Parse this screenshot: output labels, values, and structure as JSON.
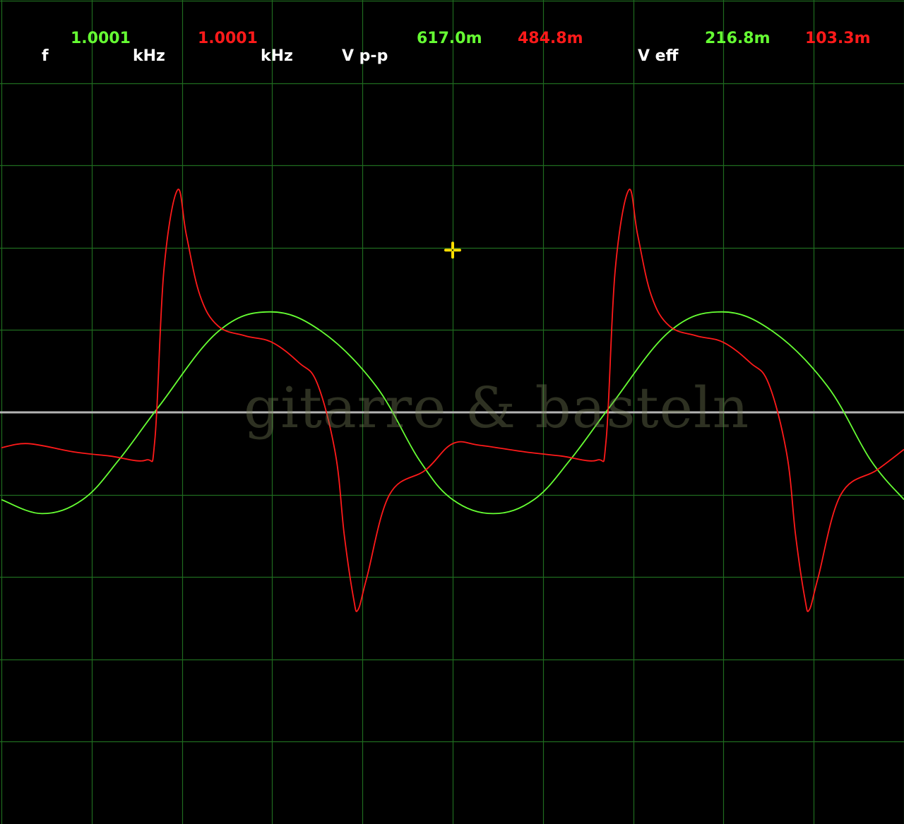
{
  "readouts": {
    "freq_label": "f",
    "freq_ch1": "1.0001",
    "freq_unit_ch1": "kHz",
    "freq_ch2": "1.0001",
    "freq_unit_ch2": "kHz",
    "vpp_label": "V p-p",
    "vpp_ch1": "617.0m",
    "vpp_ch2": "484.8m",
    "veff_label": "V eff",
    "veff_ch1": "216.8m",
    "veff_ch2": "103.3m"
  },
  "watermark": "gitarre & basteln",
  "colors": {
    "background": "#000000",
    "grid": "#1f6b1f",
    "ch1": "#66ff33",
    "ch2": "#ff1a1a",
    "zero_line": "#b4b4b4",
    "cursor": "#ffdd00"
  },
  "chart_data": {
    "type": "line",
    "title": "",
    "xlabel": "",
    "ylabel": "",
    "grid": true,
    "grid_divisions": {
      "x": 10,
      "y": 10
    },
    "xlim": [
      0,
      10
    ],
    "ylim": [
      -5,
      5
    ],
    "zero_line": 0,
    "cursor": {
      "x": 5.0,
      "y": 1.97
    },
    "series": [
      {
        "channel": "ch1",
        "color": "#66ff33",
        "points": [
          [
            0.0,
            -1.06
          ],
          [
            0.45,
            -1.23
          ],
          [
            0.9,
            -1.06
          ],
          [
            1.3,
            -0.58
          ],
          [
            1.75,
            0.08
          ],
          [
            2.4,
            0.98
          ],
          [
            2.98,
            1.22
          ],
          [
            3.55,
            0.98
          ],
          [
            4.15,
            0.32
          ],
          [
            4.63,
            -0.58
          ],
          [
            5.0,
            -1.06
          ],
          [
            5.45,
            -1.23
          ],
          [
            5.9,
            -1.06
          ],
          [
            6.3,
            -0.58
          ],
          [
            6.75,
            0.08
          ],
          [
            7.4,
            0.98
          ],
          [
            7.98,
            1.22
          ],
          [
            8.55,
            0.98
          ],
          [
            9.15,
            0.32
          ],
          [
            9.63,
            -0.58
          ],
          [
            10.0,
            -1.06
          ]
        ]
      },
      {
        "channel": "ch2",
        "color": "#ff1a1a",
        "points": [
          [
            0.0,
            -0.43
          ],
          [
            0.3,
            -0.38
          ],
          [
            0.8,
            -0.48
          ],
          [
            1.2,
            -0.53
          ],
          [
            1.6,
            -0.58
          ],
          [
            1.7,
            -0.33
          ],
          [
            1.8,
            1.72
          ],
          [
            1.95,
            2.7
          ],
          [
            2.05,
            2.15
          ],
          [
            2.2,
            1.42
          ],
          [
            2.4,
            1.05
          ],
          [
            2.7,
            0.93
          ],
          [
            3.0,
            0.85
          ],
          [
            3.3,
            0.6
          ],
          [
            3.5,
            0.35
          ],
          [
            3.7,
            -0.5
          ],
          [
            3.8,
            -1.5
          ],
          [
            3.9,
            -2.25
          ],
          [
            3.95,
            -2.4
          ],
          [
            4.05,
            -2.0
          ],
          [
            4.3,
            -1.0
          ],
          [
            4.7,
            -0.7
          ],
          [
            5.0,
            -0.38
          ],
          [
            5.3,
            -0.4
          ],
          [
            5.8,
            -0.48
          ],
          [
            6.2,
            -0.53
          ],
          [
            6.6,
            -0.58
          ],
          [
            6.7,
            -0.33
          ],
          [
            6.8,
            1.72
          ],
          [
            6.95,
            2.7
          ],
          [
            7.05,
            2.15
          ],
          [
            7.2,
            1.42
          ],
          [
            7.4,
            1.05
          ],
          [
            7.7,
            0.93
          ],
          [
            8.0,
            0.85
          ],
          [
            8.3,
            0.6
          ],
          [
            8.5,
            0.35
          ],
          [
            8.7,
            -0.5
          ],
          [
            8.8,
            -1.5
          ],
          [
            8.9,
            -2.25
          ],
          [
            8.95,
            -2.4
          ],
          [
            9.05,
            -2.0
          ],
          [
            9.3,
            -1.0
          ],
          [
            9.7,
            -0.7
          ],
          [
            10.0,
            -0.45
          ]
        ]
      }
    ]
  }
}
